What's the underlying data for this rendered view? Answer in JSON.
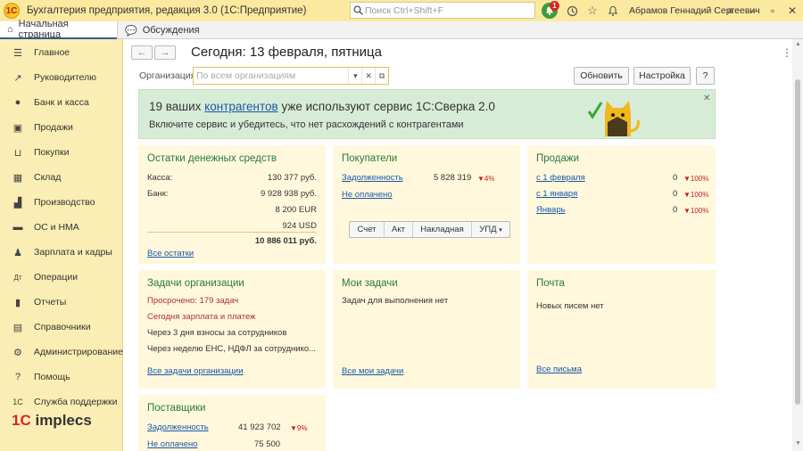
{
  "titlebar": {
    "app_icon": "1C",
    "title": "Бухгалтерия предприятия, редакция 3.0  (1С:Предприятие)",
    "search_placeholder": "Поиск Ctrl+Shift+F",
    "notification_count": "1",
    "user": "Абрамов Геннадий Сергеевич"
  },
  "tabs": [
    {
      "label": "Начальная страница",
      "icon": "home-icon"
    },
    {
      "label": "Обсуждения",
      "icon": "chat-icon"
    }
  ],
  "sidebar": {
    "items": [
      {
        "label": "Главное",
        "icon": "menu-icon"
      },
      {
        "label": "Руководителю",
        "icon": "chart-line-icon"
      },
      {
        "label": "Банк и касса",
        "icon": "coin-icon"
      },
      {
        "label": "Продажи",
        "icon": "bag-icon"
      },
      {
        "label": "Покупки",
        "icon": "cart-icon"
      },
      {
        "label": "Склад",
        "icon": "warehouse-icon"
      },
      {
        "label": "Производство",
        "icon": "factory-icon"
      },
      {
        "label": "ОС и НМА",
        "icon": "truck-icon"
      },
      {
        "label": "Зарплата и кадры",
        "icon": "person-icon"
      },
      {
        "label": "Операции",
        "icon": "operations-icon"
      },
      {
        "label": "Отчеты",
        "icon": "bar-chart-icon"
      },
      {
        "label": "Справочники",
        "icon": "book-icon"
      },
      {
        "label": "Администрирование",
        "icon": "gear-icon"
      },
      {
        "label": "Помощь",
        "icon": "help-icon"
      },
      {
        "label": "Служба поддержки",
        "icon": "support-icon"
      }
    ],
    "logo_1c": "1С",
    "logo_text": "implecs"
  },
  "header": {
    "date_title": "Сегодня: 13 февраля, пятница",
    "org_label": "Организация:",
    "org_placeholder": "По всем организациям",
    "refresh_label": "Обновить",
    "settings_label": "Настройка",
    "help_label": "?"
  },
  "banner": {
    "text_before": "19 ваших ",
    "link": "контрагентов",
    "text_after": " уже используют сервис 1С:Сверка 2.0",
    "line2": "Включите сервис и убедитесь, что нет расхождений с контрагентами"
  },
  "cash": {
    "title": "Остатки денежных средств",
    "rows": [
      {
        "label": "Касса:",
        "value": "130 377 руб."
      },
      {
        "label": "Банк:",
        "value": "9 928 938 руб."
      },
      {
        "label": "",
        "value": "8 200 EUR"
      },
      {
        "label": "",
        "value": "924 USD"
      }
    ],
    "total": "10 886 011 руб.",
    "link": "Все остатки"
  },
  "buyers": {
    "title": "Покупатели",
    "debt_label": "Задолженность",
    "debt_value": "5 828 319",
    "debt_delta": "▼4%",
    "unpaid_label": "Не оплачено",
    "doc_buttons": [
      "Счет",
      "Акт",
      "Накладная",
      "УПД"
    ]
  },
  "sales": {
    "title": "Продажи",
    "rows": [
      {
        "label": "с 1 февраля",
        "value": "0",
        "delta": "▼100%"
      },
      {
        "label": "с 1 января",
        "value": "0",
        "delta": "▼100%"
      },
      {
        "label": "Январь",
        "value": "0",
        "delta": "▼100%"
      }
    ]
  },
  "org_tasks": {
    "title": "Задачи организации",
    "rows": [
      "Просрочено: 179 задач",
      "Сегодня зарплата и платеж",
      "Через 3 дня взносы за сотрудников",
      "Через неделю ЕНС, НДФЛ за сотруднико..."
    ],
    "link": "Все задачи организации"
  },
  "my_tasks": {
    "title": "Мои задачи",
    "text": "Задач для выполнения нет",
    "link": "Все мои задачи"
  },
  "mail": {
    "title": "Почта",
    "text": "Новых писем нет",
    "link": "Все письма"
  },
  "suppliers": {
    "title": "Поставщики",
    "debt_label": "Задолженность",
    "debt_value": "41 923 702",
    "debt_delta": "▼9%",
    "unpaid_label": "Не оплачено",
    "unpaid_value": "75 500"
  }
}
